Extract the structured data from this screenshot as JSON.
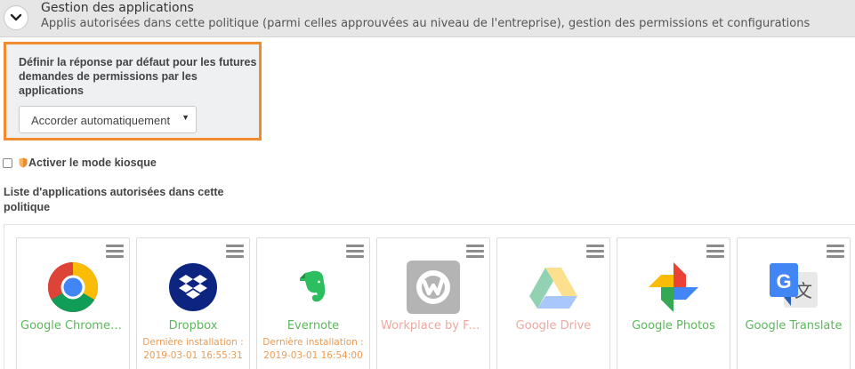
{
  "header": {
    "title": "Gestion des applications",
    "subtitle": "Applis autorisées dans cette politique (parmi celles approuvées au niveau de l'entreprise), gestion des permissions et configurations",
    "collapse_icon": "chevron-down-icon"
  },
  "permissions": {
    "label": "Définir la réponse par défaut pour les futures demandes de permissions par les applications",
    "selected": "Accorder automatiquement"
  },
  "kiosk": {
    "label": "Activer le mode kiosque",
    "checked": false,
    "icon": "shield-icon"
  },
  "apps_list": {
    "title": "Liste d'applications autorisées dans cette politique",
    "apps": [
      {
        "name": "Google Chrome: ...",
        "icon": "chrome-icon",
        "disabled": false,
        "install_label": "",
        "install_date": ""
      },
      {
        "name": "Dropbox",
        "icon": "dropbox-icon",
        "disabled": false,
        "install_label": "Dernière installation :",
        "install_date": "2019-03-01 16:55:31"
      },
      {
        "name": "Evernote",
        "icon": "evernote-icon",
        "disabled": false,
        "install_label": "Dernière installation :",
        "install_date": "2019-03-01 16:54:00"
      },
      {
        "name": "Workplace by Fac...",
        "icon": "workplace-icon",
        "disabled": true,
        "install_label": "",
        "install_date": ""
      },
      {
        "name": "Google Drive",
        "icon": "drive-icon",
        "disabled": true,
        "install_label": "",
        "install_date": ""
      },
      {
        "name": "Google Photos",
        "icon": "photos-icon",
        "disabled": false,
        "install_label": "",
        "install_date": ""
      },
      {
        "name": "Google Translate",
        "icon": "translate-icon",
        "disabled": false,
        "install_label": "",
        "install_date": ""
      }
    ]
  },
  "colors": {
    "accent_orange": "#f28a2e",
    "enabled_green": "#5cb85c",
    "disabled_pink": "#f0a8a0",
    "install_orange": "#ec9b55"
  }
}
